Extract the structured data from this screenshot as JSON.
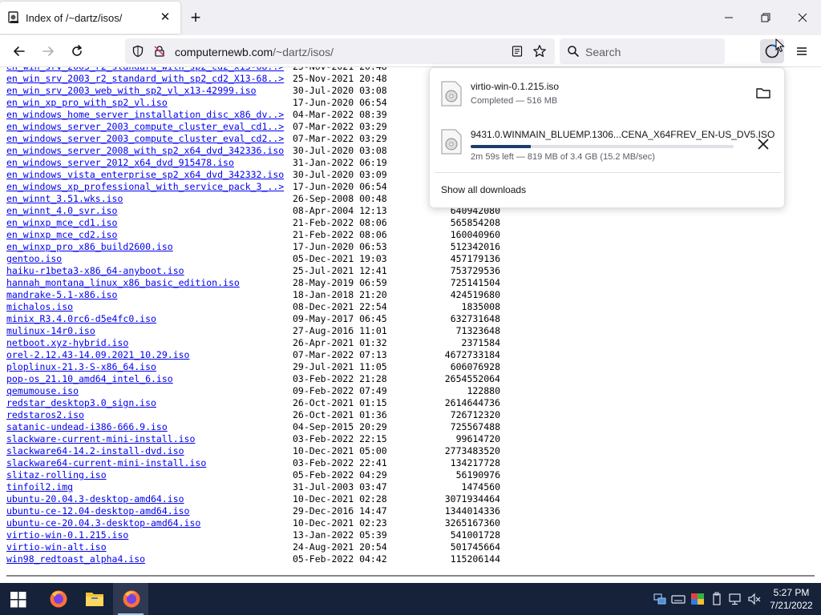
{
  "browser": {
    "tab": {
      "title": "Index of /~dartz/isos/"
    },
    "url": {
      "host": "computernewb.com",
      "path": "/~dartz/isos/"
    },
    "search": {
      "placeholder": "Search"
    }
  },
  "listing": {
    "rows": [
      {
        "name": "en_win_srv_2003_r2_standard_with_sp2_cd2_x13-68..>",
        "date": "25-Nov-2021 20:48",
        "size": ""
      },
      {
        "name": "en_win_srv_2003_r2_standard_with_sp2_cd2_X13-68..>",
        "date": "25-Nov-2021 20:48",
        "size": ""
      },
      {
        "name": "en_win_srv_2003_web_with_sp2_vl_x13-42999.iso",
        "date": "30-Jul-2020 03:08",
        "size": ""
      },
      {
        "name": "en_win_xp_pro_with_sp2_vl.iso",
        "date": "17-Jun-2020 06:54",
        "size": ""
      },
      {
        "name": "en_windows_home_server_installation_disc_x86_dv..>",
        "date": "04-Mar-2022 08:39",
        "size": ""
      },
      {
        "name": "en_windows_server_2003_compute_cluster_eval_cd1..>",
        "date": "07-Mar-2022 03:29",
        "size": ""
      },
      {
        "name": "en_windows_server_2003_compute_cluster_eval_cd2..>",
        "date": "07-Mar-2022 03:29",
        "size": ""
      },
      {
        "name": "en_windows_server_2008_with_sp2_x64_dvd_342336.iso",
        "date": "30-Jul-2020 03:08",
        "size": ""
      },
      {
        "name": "en_windows_server_2012_x64_dvd_915478.iso",
        "date": "31-Jan-2022 06:19",
        "size": ""
      },
      {
        "name": "en_windows_vista_enterprise_sp2_x64_dvd_342332.iso",
        "date": "30-Jul-2020 03:09",
        "size": ""
      },
      {
        "name": "en_windows_xp_professional_with_service_pack_3_..>",
        "date": "17-Jun-2020 06:54",
        "size": ""
      },
      {
        "name": "en_winnt_3.51.wks.iso",
        "date": "26-Sep-2008 00:48",
        "size": ""
      },
      {
        "name": "en_winnt_4.0_svr.iso",
        "date": "08-Apr-2004 12:13",
        "size": "640942080"
      },
      {
        "name": "en_winxp_mce_cd1.iso",
        "date": "21-Feb-2022 08:06",
        "size": "565854208"
      },
      {
        "name": "en_winxp_mce_cd2.iso",
        "date": "21-Feb-2022 08:06",
        "size": "160040960"
      },
      {
        "name": "en_winxp_pro_x86_build2600.iso",
        "date": "17-Jun-2020 06:53",
        "size": "512342016"
      },
      {
        "name": "gentoo.iso",
        "date": "05-Dec-2021 19:03",
        "size": "457179136"
      },
      {
        "name": "haiku-r1beta3-x86_64-anyboot.iso",
        "date": "25-Jul-2021 12:41",
        "size": "753729536"
      },
      {
        "name": "hannah_montana_linux_x86_basic_edition.iso",
        "date": "28-May-2019 06:59",
        "size": "725141504"
      },
      {
        "name": "mandrake-5.1-x86.iso",
        "date": "18-Jan-2018 21:20",
        "size": "424519680"
      },
      {
        "name": "michalos.iso",
        "date": "08-Dec-2021 22:54",
        "size": "1835008"
      },
      {
        "name": "minix_R3.4.0rc6-d5e4fc0.iso",
        "date": "09-May-2017 06:45",
        "size": "632731648"
      },
      {
        "name": "mulinux-14r0.iso",
        "date": "27-Aug-2016 11:01",
        "size": "71323648"
      },
      {
        "name": "netboot.xyz-hybrid.iso",
        "date": "26-Apr-2021 01:32",
        "size": "2371584"
      },
      {
        "name": "orel-2.12.43-14.09.2021_10.29.iso",
        "date": "07-Mar-2022 07:13",
        "size": "4672733184"
      },
      {
        "name": "ploplinux-21.3-S-x86_64.iso",
        "date": "29-Jul-2021 11:05",
        "size": "606076928"
      },
      {
        "name": "pop-os_21.10_amd64_intel_6.iso",
        "date": "03-Feb-2022 21:28",
        "size": "2654552064"
      },
      {
        "name": "qemumouse.iso",
        "date": "09-Feb-2022 07:49",
        "size": "122880"
      },
      {
        "name": "redstar_desktop3.0_sign.iso",
        "date": "26-Oct-2021 01:15",
        "size": "2614644736"
      },
      {
        "name": "redstaros2.iso",
        "date": "26-Oct-2021 01:36",
        "size": "726712320"
      },
      {
        "name": "satanic-undead-i386-666.9.iso",
        "date": "04-Sep-2015 20:29",
        "size": "725567488"
      },
      {
        "name": "slackware-current-mini-install.iso",
        "date": "03-Feb-2022 22:15",
        "size": "99614720"
      },
      {
        "name": "slackware64-14.2-install-dvd.iso",
        "date": "10-Dec-2021 05:00",
        "size": "2773483520"
      },
      {
        "name": "slackware64-current-mini-install.iso",
        "date": "03-Feb-2022 22:41",
        "size": "134217728"
      },
      {
        "name": "slitaz-rolling.iso",
        "date": "05-Feb-2022 04:29",
        "size": "56190976"
      },
      {
        "name": "tinfoil2.img",
        "date": "31-Jul-2003 03:47",
        "size": "1474560"
      },
      {
        "name": "ubuntu-20.04.3-desktop-amd64.iso",
        "date": "10-Dec-2021 02:28",
        "size": "3071934464"
      },
      {
        "name": "ubuntu-ce-12.04-desktop-amd64.iso",
        "date": "29-Dec-2016 14:47",
        "size": "1344014336"
      },
      {
        "name": "ubuntu-ce-20.04.3-desktop-amd64.iso",
        "date": "10-Dec-2021 02:23",
        "size": "3265167360"
      },
      {
        "name": "virtio-win-0.1.215.iso",
        "date": "13-Jan-2022 05:39",
        "size": "541001728"
      },
      {
        "name": "virtio-win-alt.iso",
        "date": "24-Aug-2021 20:54",
        "size": "501745664"
      },
      {
        "name": "win98_redtoast_alpha4.iso",
        "date": "05-Feb-2022 04:42",
        "size": "115206144"
      }
    ]
  },
  "downloads": {
    "items": [
      {
        "name": "virtio-win-0.1.215.iso",
        "status": "Completed — 516 MB",
        "action_icon": "folder-icon"
      },
      {
        "name": "9431.0.WINMAIN_BLUEMP.1306...CENA_X64FREV_EN-US_DV5.ISO",
        "status": "2m 59s left — 819 MB of 3.4 GB (15.2 MB/sec)",
        "progress_fraction": 0.23,
        "action_icon": "close-icon"
      }
    ],
    "show_all_label": "Show all downloads"
  },
  "taskbar": {
    "time": "5:27 PM",
    "date": "7/21/2022"
  },
  "colors": {
    "link": "#0000ee",
    "taskbar": "#16213a",
    "progress": "#1c3e6e"
  }
}
